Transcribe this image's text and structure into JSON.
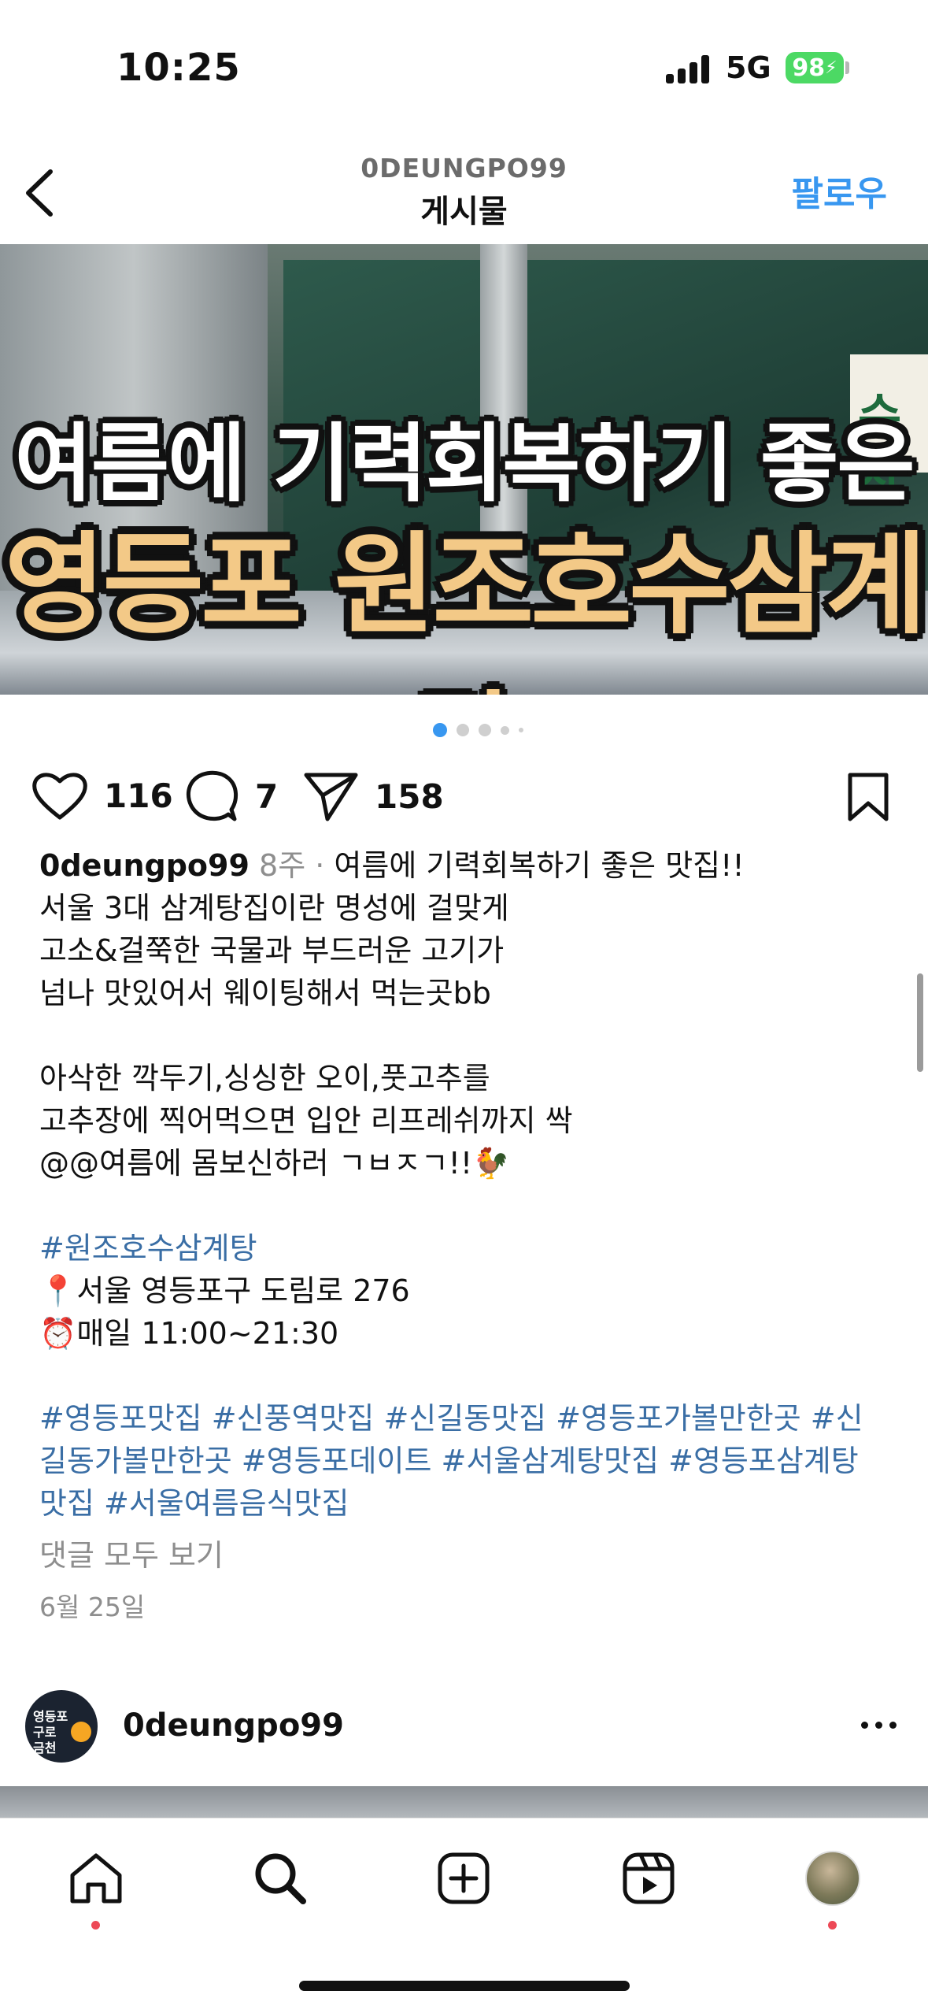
{
  "status_bar": {
    "time": "10:25",
    "network": "5G",
    "battery": "98"
  },
  "header": {
    "username": "0DEUNGPO99",
    "title": "게시물",
    "follow_label": "팔로우"
  },
  "post": {
    "image_text": {
      "line1": "여름에 기력회복하기 좋은",
      "line2": "영등포 원조호수삼계탕",
      "sign": "수삼"
    },
    "carousel": {
      "total": 5,
      "active_index": 0
    },
    "likes": "116",
    "comments": "7",
    "shares": "158",
    "caption": {
      "username": "0deungpo99",
      "age": "8주",
      "separator": " · ",
      "first_line": "여름에 기력회복하기 좋은 맛집!!",
      "lines_a": [
        "서울 3대 삼계탕집이란 명성에 걸맞게",
        "고소&걸쭉한 국물과 부드러운 고기가",
        "넘나 맛있어서 웨이팅해서 먹는곳bb"
      ],
      "lines_b": [
        "아삭한 깍두기,싱싱한 오이,풋고추를",
        "고추장에 찍어먹으면 입안 리프레쉬까지 싹",
        "@@여름에 몸보신하러 ㄱㅂㅈㄱ!!🐓"
      ],
      "tag_main": "#원조호수삼계탕",
      "location": "📍서울 영등포구 도림로 276",
      "hours": "⏰매일 11:00~21:30",
      "hashtags_line1": "#영등포맛집 #신풍역맛집 #신길동맛집 #영등포가볼만한곳 #신",
      "hashtags_line2": "길동가볼만한곳 #영등포데이트 #서울삼계탕맛집 #영등포삼계탕",
      "hashtags_line3": "맛집 #서울여름음식맛집"
    },
    "view_comments": "댓글 모두 보기",
    "date": "6월 25일"
  },
  "next_post": {
    "username": "0deungpo99",
    "avatar_text": [
      "영등포",
      "구로",
      "금천"
    ]
  },
  "nav": {
    "items": [
      "home-icon",
      "search-icon",
      "create-icon",
      "reels-icon",
      "profile-avatar"
    ]
  },
  "colors": {
    "accent_blue": "#3897f0",
    "hashtag_blue": "#3a6ea5",
    "notification_red": "#ed4956",
    "battery_green": "#4cd964",
    "headline_yellow": "#f3c987"
  }
}
